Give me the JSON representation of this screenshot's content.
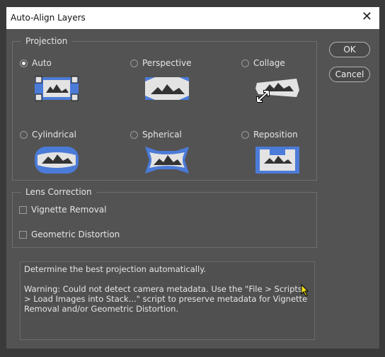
{
  "window": {
    "title": "Auto-Align Layers"
  },
  "projection": {
    "legend": "Projection",
    "options": [
      {
        "label": "Auto",
        "selected": true
      },
      {
        "label": "Perspective",
        "selected": false
      },
      {
        "label": "Collage",
        "selected": false
      },
      {
        "label": "Cylindrical",
        "selected": false
      },
      {
        "label": "Spherical",
        "selected": false
      },
      {
        "label": "Reposition",
        "selected": false
      }
    ]
  },
  "lens": {
    "legend": "Lens Correction",
    "vignette": {
      "label": "Vignette Removal",
      "checked": false
    },
    "geometric": {
      "label": "Geometric Distortion",
      "checked": false
    }
  },
  "buttons": {
    "ok": "OK",
    "cancel": "Cancel"
  },
  "description": {
    "line1": "Determine the best projection automatically.",
    "line2": "Warning: Could not detect camera metadata. Use the \"File > Scripts > Load Images into Stack...\" script to preserve metadata for Vignette Removal and/or Geometric Distortion."
  },
  "colors": {
    "accent": "#4b7bd8",
    "panel": "#535353",
    "icon_light": "#e3e3e3"
  }
}
